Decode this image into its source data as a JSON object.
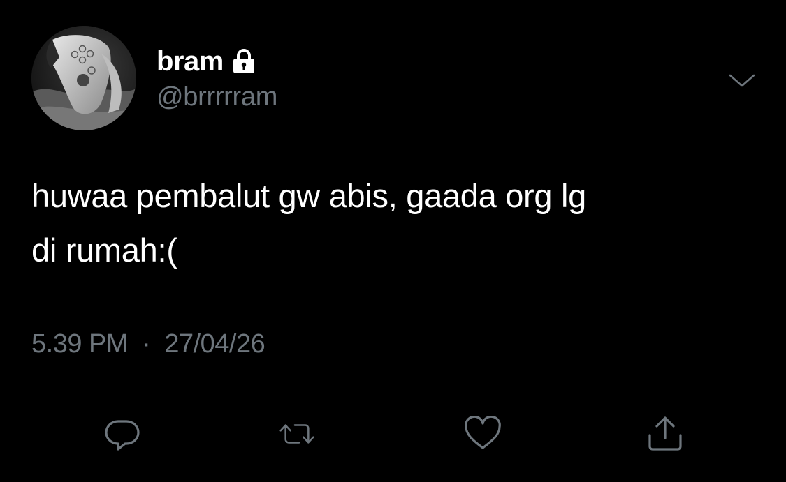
{
  "tweet": {
    "display_name": "bram",
    "handle": "@brrrrram",
    "protected_icon": "lock-icon",
    "text_line_1": "huwaa pembalut gw abis, gaada org lg",
    "text_line_2": "di rumah:(",
    "time": "5.39 PM",
    "separator": "·",
    "date": "27/04/26"
  },
  "actions": [
    {
      "name": "reply",
      "icon": "reply-bubble-icon"
    },
    {
      "name": "retweet",
      "icon": "retweet-icon"
    },
    {
      "name": "like",
      "icon": "heart-icon"
    },
    {
      "name": "share",
      "icon": "share-icon"
    }
  ],
  "menu_icon": "chevron-down-icon",
  "colors": {
    "background": "#000000",
    "primary_text": "#ffffff",
    "secondary_text": "#6e767d",
    "icon": "#6e767d",
    "divider": "#2f3336"
  }
}
